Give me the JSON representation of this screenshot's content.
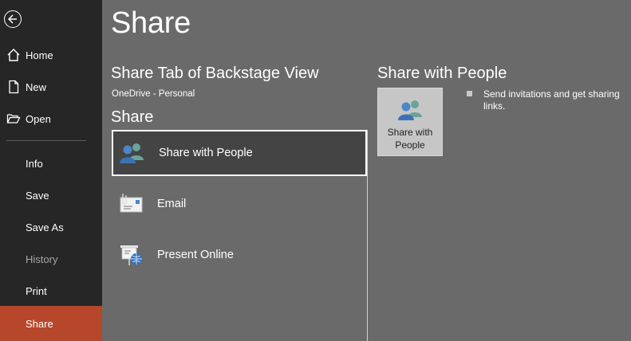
{
  "nav": {
    "items": [
      {
        "label": "Home"
      },
      {
        "label": "New"
      },
      {
        "label": "Open"
      },
      {
        "label": "Info"
      },
      {
        "label": "Save"
      },
      {
        "label": "Save As"
      },
      {
        "label": "History"
      },
      {
        "label": "Print"
      },
      {
        "label": "Share"
      }
    ],
    "active": "Share",
    "active_color": "#b7472a"
  },
  "main": {
    "page_title": "Share",
    "section_title": "Share Tab of Backstage View",
    "account": "OneDrive - Personal",
    "share_heading": "Share",
    "options": [
      {
        "label": "Share with People",
        "icon": "people-icon",
        "selected": true
      },
      {
        "label": "Email",
        "icon": "email-icon",
        "selected": false
      },
      {
        "label": "Present Online",
        "icon": "present-online-icon",
        "selected": false
      }
    ]
  },
  "detail": {
    "title": "Share with People",
    "tile_label": "Share with People",
    "description": "Send invitations and get sharing links."
  }
}
